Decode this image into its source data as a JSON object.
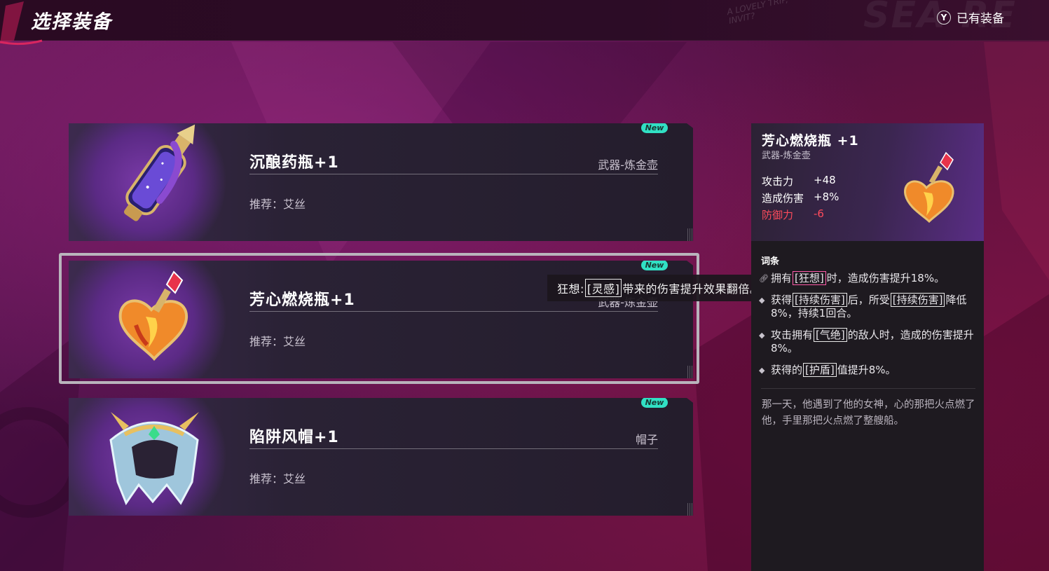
{
  "header": {
    "title": "选择装备",
    "owned_key": "Y",
    "owned_label": "已有装备",
    "bg_word": "SEA RE",
    "bg_scribble_1": "A LOVELY TRIP,",
    "bg_scribble_2": "INVIT?"
  },
  "equipment_list": [
    {
      "name": "沉酿药瓶+1",
      "type": "武器-炼金壶",
      "recommend": "推荐：艾丝",
      "badge": "New",
      "icon": "purple-potion-bottle-icon"
    },
    {
      "name": "芳心燃烧瓶+1",
      "type": "武器-炼金壶",
      "recommend": "推荐：艾丝",
      "badge": "New",
      "icon": "heart-flame-flask-icon",
      "selected": true
    },
    {
      "name": "陷阱风帽+1",
      "type": "帽子",
      "recommend": "推荐：艾丝",
      "badge": "New",
      "icon": "ice-hood-icon"
    }
  ],
  "tooltip": {
    "prefix": "狂想:",
    "tag": "[灵感]",
    "suffix": "带来的伤害提升效果翻倍。"
  },
  "detail": {
    "name": "芳心燃烧瓶 +1",
    "type": "武器-炼金壶",
    "stats": [
      {
        "label": "攻击力",
        "value": "+48"
      },
      {
        "label": "造成伤害",
        "value": "+8%"
      },
      {
        "label": "防御力",
        "value": "-6",
        "negative": true
      }
    ],
    "section_title": "词条",
    "affixes": {
      "a1_pre": "拥有",
      "a1_tag": "[狂想]",
      "a1_post": "时，造成伤害提升18%。",
      "a2_pre": "获得",
      "a2_tag": "[持续伤害]",
      "a2_mid": "后，所受",
      "a2_tag2": "[持续伤害]",
      "a2_post": "降低8%，持续1回合。",
      "a3_pre": "攻击拥有",
      "a3_tag": "[气绝]",
      "a3_post": "的敌人时，造成的伤害提升8%。",
      "a4_pre": "获得的",
      "a4_tag": "[护盾]",
      "a4_post": "值提升8%。"
    },
    "flavor": "那一天，他遇到了他的女神，心的那把火点燃了他，手里那把火点燃了整艘船。"
  },
  "colors": {
    "new_badge": "#31e0c4",
    "negative_stat": "#ff4b5c",
    "selected_frame": "#b9b4bc",
    "highlight_tag": "#ff5aa8"
  }
}
